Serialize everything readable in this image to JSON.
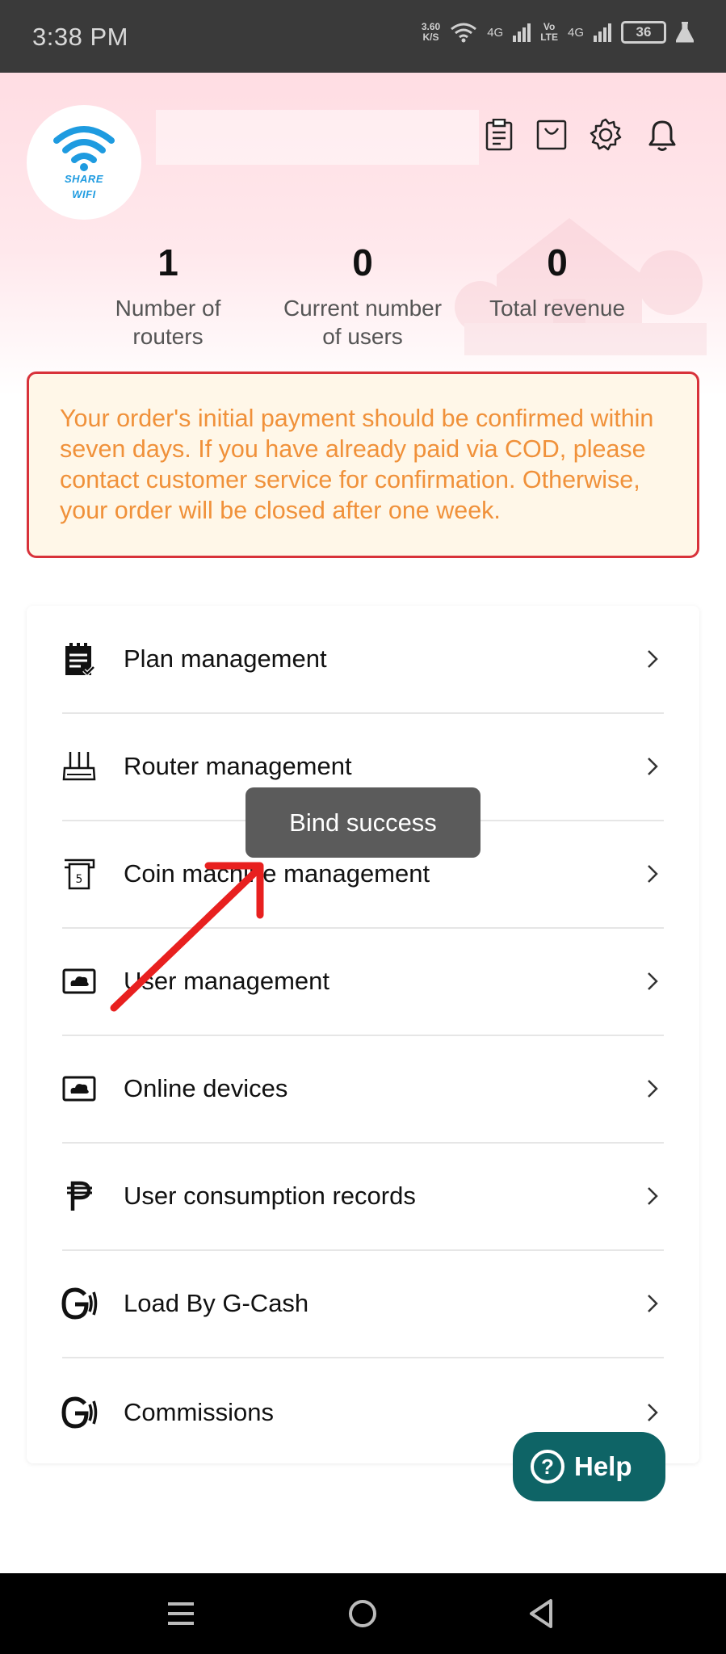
{
  "status_bar": {
    "time": "3:38 PM",
    "net_speed_value": "3.60",
    "net_speed_unit": "K/S",
    "signal_1": "4G",
    "volte_top": "Vo",
    "volte_bottom": "LTE",
    "signal_2": "4G",
    "battery": "36"
  },
  "header": {
    "logo_line1": "SHARE",
    "logo_line2": "WIFI",
    "icons": [
      "clipboard-icon",
      "shopping-bag-icon",
      "gear-icon",
      "bell-icon"
    ]
  },
  "stats": [
    {
      "value": "1",
      "label_line1": "Number of",
      "label_line2": "routers"
    },
    {
      "value": "0",
      "label_line1": "Current number",
      "label_line2": "of users"
    },
    {
      "value": "0",
      "label_line1": "Total revenue",
      "label_line2": ""
    }
  ],
  "notice": {
    "text": "Your order's initial payment should be confirmed within seven days. If you have already paid via COD, please contact customer service for confirmation. Otherwise, your order will be closed after one week."
  },
  "menu": {
    "items": [
      {
        "label": "Plan management",
        "icon": "plan-list-icon"
      },
      {
        "label": "Router management",
        "icon": "router-icon"
      },
      {
        "label": "Coin machine management",
        "icon": "coin-machine-icon"
      },
      {
        "label": "User management",
        "icon": "cloud-screen-icon"
      },
      {
        "label": "Online devices",
        "icon": "cloud-screen-icon"
      },
      {
        "label": "User consumption records",
        "icon": "peso-icon"
      },
      {
        "label": "Load By G-Cash",
        "icon": "gcash-icon"
      },
      {
        "label": "Commissions",
        "icon": "gcash-icon"
      }
    ]
  },
  "toast": {
    "text": "Bind success"
  },
  "help": {
    "label": "Help",
    "glyph": "?"
  },
  "colors": {
    "notice_text": "#f0913a",
    "notice_border": "#d8323a",
    "help_bg": "#0e6466",
    "arrow": "#e8201f",
    "logo_blue": "#1e9be0"
  }
}
